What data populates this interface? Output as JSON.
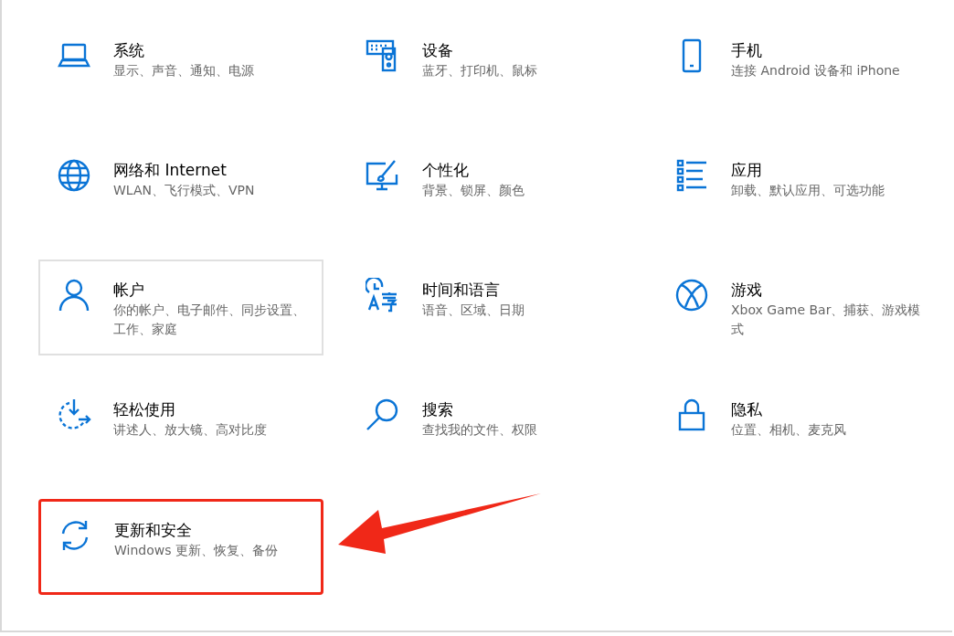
{
  "tiles": [
    {
      "kind": "system",
      "title": "系统",
      "subtitle": "显示、声音、通知、电源",
      "hovered": false,
      "highlighted": false
    },
    {
      "kind": "devices",
      "title": "设备",
      "subtitle": "蓝牙、打印机、鼠标",
      "hovered": false,
      "highlighted": false
    },
    {
      "kind": "phone",
      "title": "手机",
      "subtitle": "连接 Android 设备和 iPhone",
      "hovered": false,
      "highlighted": false
    },
    {
      "kind": "network",
      "title": "网络和 Internet",
      "subtitle": "WLAN、飞行模式、VPN",
      "hovered": false,
      "highlighted": false
    },
    {
      "kind": "personalization",
      "title": "个性化",
      "subtitle": "背景、锁屏、颜色",
      "hovered": false,
      "highlighted": false
    },
    {
      "kind": "apps",
      "title": "应用",
      "subtitle": "卸载、默认应用、可选功能",
      "hovered": false,
      "highlighted": false
    },
    {
      "kind": "accounts",
      "title": "帐户",
      "subtitle": "你的帐户、电子邮件、同步设置、工作、家庭",
      "hovered": true,
      "highlighted": false
    },
    {
      "kind": "time",
      "title": "时间和语言",
      "subtitle": "语音、区域、日期",
      "hovered": false,
      "highlighted": false
    },
    {
      "kind": "gaming",
      "title": "游戏",
      "subtitle": "Xbox Game Bar、捕获、游戏模式",
      "hovered": false,
      "highlighted": false
    },
    {
      "kind": "ease",
      "title": "轻松使用",
      "subtitle": "讲述人、放大镜、高对比度",
      "hovered": false,
      "highlighted": false
    },
    {
      "kind": "search",
      "title": "搜索",
      "subtitle": "查找我的文件、权限",
      "hovered": false,
      "highlighted": false
    },
    {
      "kind": "privacy",
      "title": "隐私",
      "subtitle": "位置、相机、麦克风",
      "hovered": false,
      "highlighted": false
    },
    {
      "kind": "update",
      "title": "更新和安全",
      "subtitle": "Windows 更新、恢复、备份",
      "hovered": false,
      "highlighted": true
    }
  ]
}
